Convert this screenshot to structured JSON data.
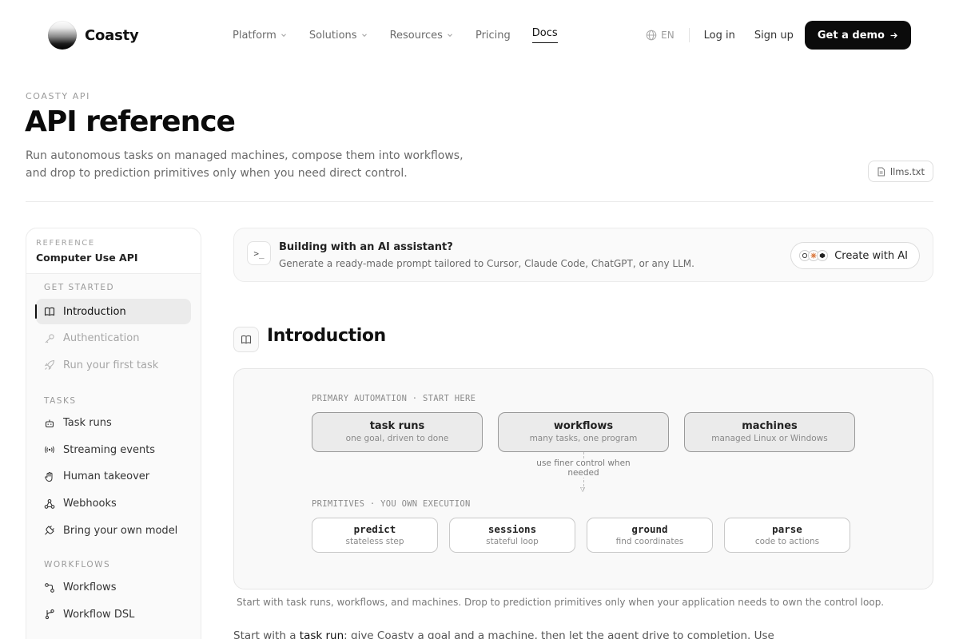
{
  "brand": {
    "name": "Coasty"
  },
  "nav": {
    "links": [
      {
        "label": "Platform",
        "dropdown": true
      },
      {
        "label": "Solutions",
        "dropdown": true
      },
      {
        "label": "Resources",
        "dropdown": true
      },
      {
        "label": "Pricing",
        "dropdown": false
      },
      {
        "label": "Docs",
        "dropdown": false,
        "active": true
      }
    ],
    "language": "EN",
    "login": "Log in",
    "signup": "Sign up",
    "demo": "Get a demo"
  },
  "header": {
    "eyebrow": "COASTY API",
    "title": "API reference",
    "description": "Run autonomous tasks on managed machines, compose them into workflows, and drop to prediction primitives only when you need direct control.",
    "llms_button": "llms.txt"
  },
  "sidebar": {
    "eyebrow": "REFERENCE",
    "title": "Computer Use API",
    "sections": [
      {
        "label": "GET STARTED",
        "items": [
          {
            "label": "Introduction",
            "icon": "book-icon",
            "active": true
          },
          {
            "label": "Authentication",
            "icon": "key-icon",
            "muted": true
          },
          {
            "label": "Run your first task",
            "icon": "rocket-icon",
            "muted": true
          }
        ]
      },
      {
        "label": "TASKS",
        "items": [
          {
            "label": "Task runs",
            "icon": "robot-icon"
          },
          {
            "label": "Streaming events",
            "icon": "broadcast-icon"
          },
          {
            "label": "Human takeover",
            "icon": "hand-icon"
          },
          {
            "label": "Webhooks",
            "icon": "webhook-icon"
          },
          {
            "label": "Bring your own model",
            "icon": "plug-icon"
          }
        ]
      },
      {
        "label": "WORKFLOWS",
        "items": [
          {
            "label": "Workflows",
            "icon": "workflow-icon"
          },
          {
            "label": "Workflow DSL",
            "icon": "branch-icon"
          }
        ]
      }
    ]
  },
  "ai_banner": {
    "icon": ">_",
    "title": "Building with an AI assistant?",
    "subtitle": "Generate a ready-made prompt tailored to Cursor, Claude Code, ChatGPT, or any LLM.",
    "button": "Create with AI"
  },
  "introduction": {
    "title": "Introduction",
    "diagram": {
      "primary_label": "PRIMARY AUTOMATION · START HERE",
      "primary": [
        {
          "title": "task runs",
          "subtitle": "one goal, driven to done"
        },
        {
          "title": "workflows",
          "subtitle": "many tasks, one program"
        },
        {
          "title": "machines",
          "subtitle": "managed Linux or Windows"
        }
      ],
      "connector": "use finer control when needed",
      "primitives_label": "PRIMITIVES · YOU OWN EXECUTION",
      "primitives": [
        {
          "title": "predict",
          "subtitle": "stateless step"
        },
        {
          "title": "sessions",
          "subtitle": "stateful loop"
        },
        {
          "title": "ground",
          "subtitle": "find coordinates"
        },
        {
          "title": "parse",
          "subtitle": "code to actions"
        }
      ]
    },
    "caption": "Start with task runs, workflows, and machines. Drop to prediction primitives only when your application needs to own the control loop.",
    "body_start": "Start with a",
    "body_link": "task run",
    "body_end": "; give Coasty a goal and a machine, then let the agent drive to completion. Use"
  }
}
